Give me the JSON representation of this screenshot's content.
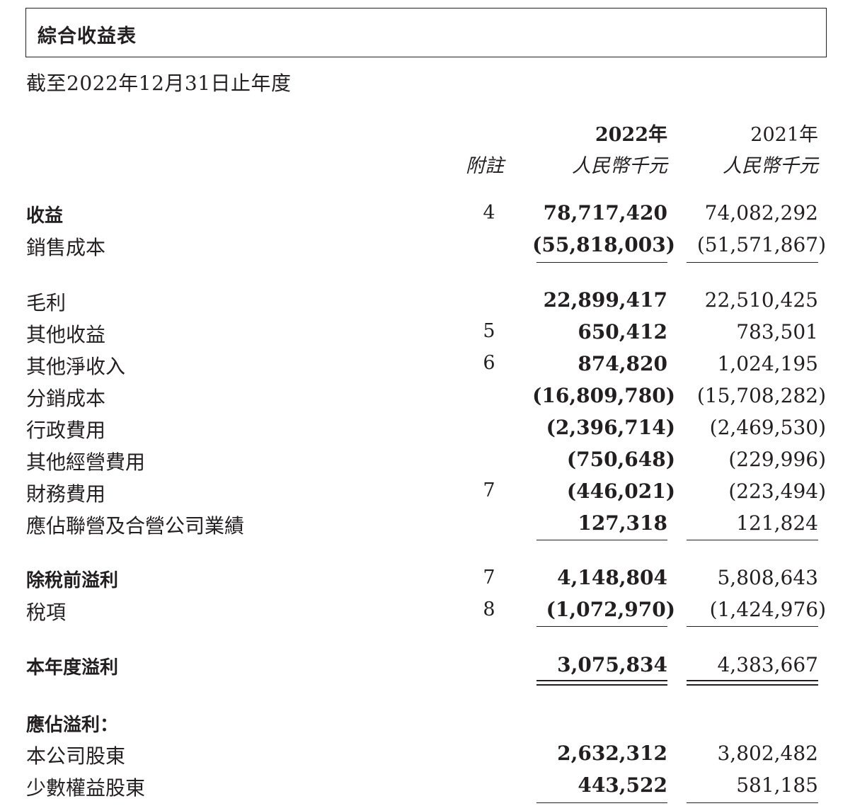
{
  "title": "綜合收益表",
  "subtitle": "截至2022年12月31日止年度",
  "columns": {
    "note_header": "附註",
    "year_2022": "2022年",
    "year_2021": "2021年",
    "unit_2022": "人民幣千元",
    "unit_2021": "人民幣千元"
  },
  "rows": [
    {
      "label": "收益",
      "note": "4",
      "v2022": "78,717,420",
      "v2021": "74,082,292"
    },
    {
      "label": "銷售成本",
      "note": "",
      "v2022": "(55,818,003)",
      "v2021": "(51,571,867)"
    },
    {
      "label": "毛利",
      "note": "",
      "v2022": "22,899,417",
      "v2021": "22,510,425"
    },
    {
      "label": "其他收益",
      "note": "5",
      "v2022": "650,412",
      "v2021": "783,501"
    },
    {
      "label": "其他淨收入",
      "note": "6",
      "v2022": "874,820",
      "v2021": "1,024,195"
    },
    {
      "label": "分銷成本",
      "note": "",
      "v2022": "(16,809,780)",
      "v2021": "(15,708,282)"
    },
    {
      "label": "行政費用",
      "note": "",
      "v2022": "(2,396,714)",
      "v2021": "(2,469,530)"
    },
    {
      "label": "其他經營費用",
      "note": "",
      "v2022": "(750,648)",
      "v2021": "(229,996)"
    },
    {
      "label": "財務費用",
      "note": "7",
      "v2022": "(446,021)",
      "v2021": "(223,494)"
    },
    {
      "label": "應佔聯營及合營公司業績",
      "note": "",
      "v2022": "127,318",
      "v2021": "121,824"
    },
    {
      "label": "除稅前溢利",
      "note": "7",
      "v2022": "4,148,804",
      "v2021": "5,808,643"
    },
    {
      "label": "稅項",
      "note": "8",
      "v2022": "(1,072,970)",
      "v2021": "(1,424,976)"
    },
    {
      "label": "本年度溢利",
      "note": "",
      "v2022": "3,075,834",
      "v2021": "4,383,667"
    },
    {
      "label": "應佔溢利："
    },
    {
      "label": "本公司股東",
      "note": "",
      "v2022": "2,632,312",
      "v2021": "3,802,482"
    },
    {
      "label": "少數權益股東",
      "note": "",
      "v2022": "443,522",
      "v2021": "581,185"
    }
  ]
}
